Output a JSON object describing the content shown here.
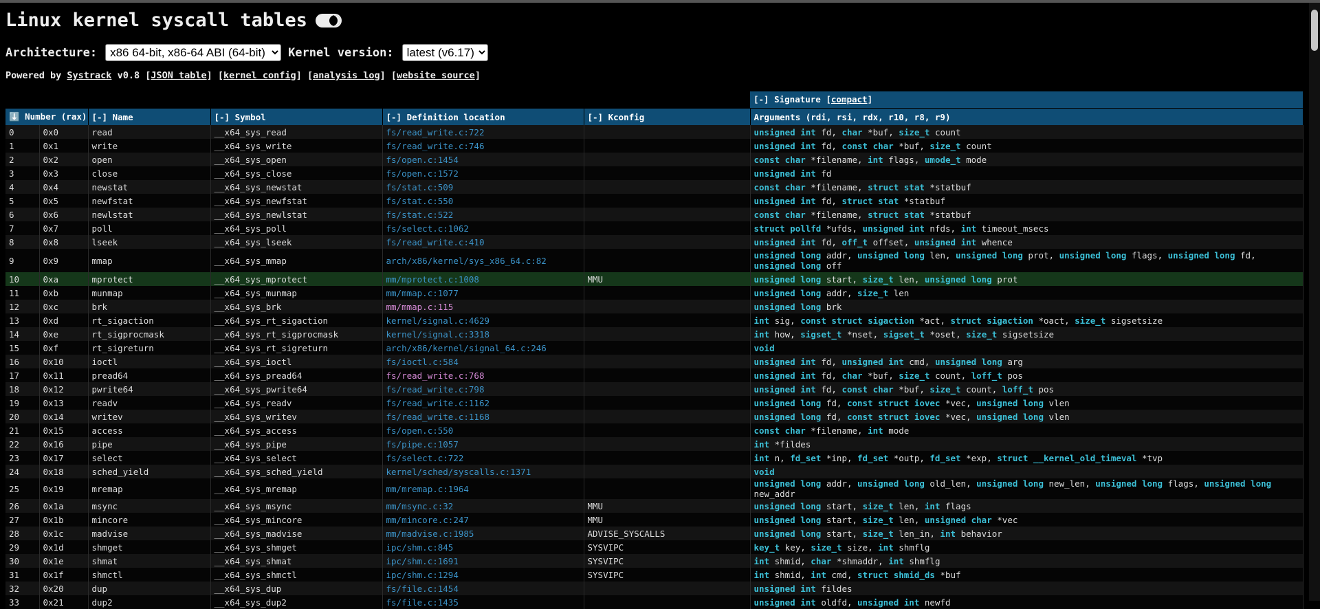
{
  "page": {
    "title": "Linux kernel syscall tables",
    "arch_label": "Architecture:",
    "arch_value": "x86 64-bit, x86-64 ABI (64-bit)",
    "kernel_label": "Kernel version:",
    "kernel_value": "latest (v6.17)",
    "powered_prefix": "Powered by ",
    "powered_link": "Systrack",
    "powered_version": " v0.8 [",
    "link_json": "JSON table",
    "link_config": "kernel config",
    "link_log": "analysis log",
    "link_source": "website source",
    "sep1": "] [",
    "sep2": "] [",
    "sep3": "] [",
    "end": "]"
  },
  "signature_header": {
    "prefix": "[-] Signature [",
    "link": "compact",
    "suffix": "]"
  },
  "columns": [
    "⬇️ Number (rax)",
    "[-] Name",
    "[-] Symbol",
    "[-] Definition location",
    "[-] Kconfig",
    "Arguments (rdi, rsi, rdx, r10, r8, r9)"
  ],
  "rows": [
    {
      "num": "0",
      "hex": "0x0",
      "name": "read",
      "symbol": "__x64_sys_read",
      "loc": "fs/read_write.c:722",
      "kconfig": "",
      "args": [
        [
          "unsigned int",
          "fd, "
        ],
        [
          "char",
          "*buf, "
        ],
        [
          "size_t",
          "count"
        ]
      ]
    },
    {
      "num": "1",
      "hex": "0x1",
      "name": "write",
      "symbol": "__x64_sys_write",
      "loc": "fs/read_write.c:746",
      "kconfig": "",
      "args": [
        [
          "unsigned int",
          "fd, "
        ],
        [
          "const char",
          "*buf, "
        ],
        [
          "size_t",
          "count"
        ]
      ]
    },
    {
      "num": "2",
      "hex": "0x2",
      "name": "open",
      "symbol": "__x64_sys_open",
      "loc": "fs/open.c:1454",
      "kconfig": "",
      "args": [
        [
          "const char",
          "*filename, "
        ],
        [
          "int",
          "flags, "
        ],
        [
          "umode_t",
          "mode"
        ]
      ]
    },
    {
      "num": "3",
      "hex": "0x3",
      "name": "close",
      "symbol": "__x64_sys_close",
      "loc": "fs/open.c:1572",
      "kconfig": "",
      "args": [
        [
          "unsigned int",
          "fd"
        ]
      ]
    },
    {
      "num": "4",
      "hex": "0x4",
      "name": "newstat",
      "symbol": "__x64_sys_newstat",
      "loc": "fs/stat.c:509",
      "kconfig": "",
      "args": [
        [
          "const char",
          "*filename, "
        ],
        [
          "struct stat",
          "*statbuf"
        ]
      ]
    },
    {
      "num": "5",
      "hex": "0x5",
      "name": "newfstat",
      "symbol": "__x64_sys_newfstat",
      "loc": "fs/stat.c:550",
      "kconfig": "",
      "args": [
        [
          "unsigned int",
          "fd, "
        ],
        [
          "struct stat",
          "*statbuf"
        ]
      ]
    },
    {
      "num": "6",
      "hex": "0x6",
      "name": "newlstat",
      "symbol": "__x64_sys_newlstat",
      "loc": "fs/stat.c:522",
      "kconfig": "",
      "args": [
        [
          "const char",
          "*filename, "
        ],
        [
          "struct stat",
          "*statbuf"
        ]
      ]
    },
    {
      "num": "7",
      "hex": "0x7",
      "name": "poll",
      "symbol": "__x64_sys_poll",
      "loc": "fs/select.c:1062",
      "kconfig": "",
      "args": [
        [
          "struct pollfd",
          "*ufds, "
        ],
        [
          "unsigned int",
          "nfds, "
        ],
        [
          "int",
          "timeout_msecs"
        ]
      ]
    },
    {
      "num": "8",
      "hex": "0x8",
      "name": "lseek",
      "symbol": "__x64_sys_lseek",
      "loc": "fs/read_write.c:410",
      "kconfig": "",
      "args": [
        [
          "unsigned int",
          "fd, "
        ],
        [
          "off_t",
          "offset, "
        ],
        [
          "unsigned int",
          "whence"
        ]
      ]
    },
    {
      "num": "9",
      "hex": "0x9",
      "name": "mmap",
      "symbol": "__x64_sys_mmap",
      "loc": "arch/x86/kernel/sys_x86_64.c:82",
      "kconfig": "",
      "tall": true,
      "args": [
        [
          "unsigned long",
          "addr, "
        ],
        [
          "unsigned long",
          "len, "
        ],
        [
          "unsigned long",
          "prot, "
        ],
        [
          "unsigned long",
          "flags, "
        ],
        [
          "unsigned long",
          "fd, "
        ],
        [
          "unsigned long",
          "off"
        ]
      ]
    },
    {
      "num": "10",
      "hex": "0xa",
      "name": "mprotect",
      "symbol": "__x64_sys_mprotect",
      "loc": "mm/mprotect.c:1008",
      "kconfig": "MMU",
      "hl": true,
      "args": [
        [
          "unsigned long",
          "start, "
        ],
        [
          "size_t",
          "len, "
        ],
        [
          "unsigned long",
          "prot"
        ]
      ]
    },
    {
      "num": "11",
      "hex": "0xb",
      "name": "munmap",
      "symbol": "__x64_sys_munmap",
      "loc": "mm/mmap.c:1077",
      "kconfig": "",
      "args": [
        [
          "unsigned long",
          "addr, "
        ],
        [
          "size_t",
          "len"
        ]
      ]
    },
    {
      "num": "12",
      "hex": "0xc",
      "name": "brk",
      "symbol": "__x64_sys_brk",
      "loc": "mm/mmap.c:115",
      "kconfig": "",
      "visited": true,
      "args": [
        [
          "unsigned long",
          "brk"
        ]
      ]
    },
    {
      "num": "13",
      "hex": "0xd",
      "name": "rt_sigaction",
      "symbol": "__x64_sys_rt_sigaction",
      "loc": "kernel/signal.c:4629",
      "kconfig": "",
      "args": [
        [
          "int",
          "sig, "
        ],
        [
          "const struct sigaction",
          "*act, "
        ],
        [
          "struct sigaction",
          "*oact, "
        ],
        [
          "size_t",
          "sigsetsize"
        ]
      ]
    },
    {
      "num": "14",
      "hex": "0xe",
      "name": "rt_sigprocmask",
      "symbol": "__x64_sys_rt_sigprocmask",
      "loc": "kernel/signal.c:3318",
      "kconfig": "",
      "args": [
        [
          "int",
          "how, "
        ],
        [
          "sigset_t",
          "*nset, "
        ],
        [
          "sigset_t",
          "*oset, "
        ],
        [
          "size_t",
          "sigsetsize"
        ]
      ]
    },
    {
      "num": "15",
      "hex": "0xf",
      "name": "rt_sigreturn",
      "symbol": "__x64_sys_rt_sigreturn",
      "loc": "arch/x86/kernel/signal_64.c:246",
      "kconfig": "",
      "args": [
        [
          "void",
          ""
        ]
      ]
    },
    {
      "num": "16",
      "hex": "0x10",
      "name": "ioctl",
      "symbol": "__x64_sys_ioctl",
      "loc": "fs/ioctl.c:584",
      "kconfig": "",
      "args": [
        [
          "unsigned int",
          "fd, "
        ],
        [
          "unsigned int",
          "cmd, "
        ],
        [
          "unsigned long",
          "arg"
        ]
      ]
    },
    {
      "num": "17",
      "hex": "0x11",
      "name": "pread64",
      "symbol": "__x64_sys_pread64",
      "loc": "fs/read_write.c:768",
      "kconfig": "",
      "visited": true,
      "args": [
        [
          "unsigned int",
          "fd, "
        ],
        [
          "char",
          "*buf, "
        ],
        [
          "size_t",
          "count, "
        ],
        [
          "loff_t",
          "pos"
        ]
      ]
    },
    {
      "num": "18",
      "hex": "0x12",
      "name": "pwrite64",
      "symbol": "__x64_sys_pwrite64",
      "loc": "fs/read_write.c:798",
      "kconfig": "",
      "args": [
        [
          "unsigned int",
          "fd, "
        ],
        [
          "const char",
          "*buf, "
        ],
        [
          "size_t",
          "count, "
        ],
        [
          "loff_t",
          "pos"
        ]
      ]
    },
    {
      "num": "19",
      "hex": "0x13",
      "name": "readv",
      "symbol": "__x64_sys_readv",
      "loc": "fs/read_write.c:1162",
      "kconfig": "",
      "args": [
        [
          "unsigned long",
          "fd, "
        ],
        [
          "const struct iovec",
          "*vec, "
        ],
        [
          "unsigned long",
          "vlen"
        ]
      ]
    },
    {
      "num": "20",
      "hex": "0x14",
      "name": "writev",
      "symbol": "__x64_sys_writev",
      "loc": "fs/read_write.c:1168",
      "kconfig": "",
      "args": [
        [
          "unsigned long",
          "fd, "
        ],
        [
          "const struct iovec",
          "*vec, "
        ],
        [
          "unsigned long",
          "vlen"
        ]
      ]
    },
    {
      "num": "21",
      "hex": "0x15",
      "name": "access",
      "symbol": "__x64_sys_access",
      "loc": "fs/open.c:550",
      "kconfig": "",
      "args": [
        [
          "const char",
          "*filename, "
        ],
        [
          "int",
          "mode"
        ]
      ]
    },
    {
      "num": "22",
      "hex": "0x16",
      "name": "pipe",
      "symbol": "__x64_sys_pipe",
      "loc": "fs/pipe.c:1057",
      "kconfig": "",
      "args": [
        [
          "int",
          "*fildes"
        ]
      ]
    },
    {
      "num": "23",
      "hex": "0x17",
      "name": "select",
      "symbol": "__x64_sys_select",
      "loc": "fs/select.c:722",
      "kconfig": "",
      "args": [
        [
          "int",
          "n, "
        ],
        [
          "fd_set",
          "*inp, "
        ],
        [
          "fd_set",
          "*outp, "
        ],
        [
          "fd_set",
          "*exp, "
        ],
        [
          "struct __kernel_old_timeval",
          "*tvp"
        ]
      ]
    },
    {
      "num": "24",
      "hex": "0x18",
      "name": "sched_yield",
      "symbol": "__x64_sys_sched_yield",
      "loc": "kernel/sched/syscalls.c:1371",
      "kconfig": "",
      "args": [
        [
          "void",
          ""
        ]
      ]
    },
    {
      "num": "25",
      "hex": "0x19",
      "name": "mremap",
      "symbol": "__x64_sys_mremap",
      "loc": "mm/mremap.c:1964",
      "kconfig": "",
      "args": [
        [
          "unsigned long",
          "addr, "
        ],
        [
          "unsigned long",
          "old_len, "
        ],
        [
          "unsigned long",
          "new_len, "
        ],
        [
          "unsigned long",
          "flags, "
        ],
        [
          "unsigned long",
          "new_addr"
        ]
      ]
    },
    {
      "num": "26",
      "hex": "0x1a",
      "name": "msync",
      "symbol": "__x64_sys_msync",
      "loc": "mm/msync.c:32",
      "kconfig": "MMU",
      "args": [
        [
          "unsigned long",
          "start, "
        ],
        [
          "size_t",
          "len, "
        ],
        [
          "int",
          "flags"
        ]
      ]
    },
    {
      "num": "27",
      "hex": "0x1b",
      "name": "mincore",
      "symbol": "__x64_sys_mincore",
      "loc": "mm/mincore.c:247",
      "kconfig": "MMU",
      "args": [
        [
          "unsigned long",
          "start, "
        ],
        [
          "size_t",
          "len, "
        ],
        [
          "unsigned char",
          "*vec"
        ]
      ]
    },
    {
      "num": "28",
      "hex": "0x1c",
      "name": "madvise",
      "symbol": "__x64_sys_madvise",
      "loc": "mm/madvise.c:1985",
      "kconfig": "ADVISE_SYSCALLS",
      "args": [
        [
          "unsigned long",
          "start, "
        ],
        [
          "size_t",
          "len_in, "
        ],
        [
          "int",
          "behavior"
        ]
      ]
    },
    {
      "num": "29",
      "hex": "0x1d",
      "name": "shmget",
      "symbol": "__x64_sys_shmget",
      "loc": "ipc/shm.c:845",
      "kconfig": "SYSVIPC",
      "args": [
        [
          "key_t",
          "key, "
        ],
        [
          "size_t",
          "size, "
        ],
        [
          "int",
          "shmflg"
        ]
      ]
    },
    {
      "num": "30",
      "hex": "0x1e",
      "name": "shmat",
      "symbol": "__x64_sys_shmat",
      "loc": "ipc/shm.c:1691",
      "kconfig": "SYSVIPC",
      "args": [
        [
          "int",
          "shmid, "
        ],
        [
          "char",
          "*shmaddr, "
        ],
        [
          "int",
          "shmflg"
        ]
      ]
    },
    {
      "num": "31",
      "hex": "0x1f",
      "name": "shmctl",
      "symbol": "__x64_sys_shmctl",
      "loc": "ipc/shm.c:1294",
      "kconfig": "SYSVIPC",
      "args": [
        [
          "int",
          "shmid, "
        ],
        [
          "int",
          "cmd, "
        ],
        [
          "struct shmid_ds",
          "*buf"
        ]
      ]
    },
    {
      "num": "32",
      "hex": "0x20",
      "name": "dup",
      "symbol": "__x64_sys_dup",
      "loc": "fs/file.c:1454",
      "kconfig": "",
      "args": [
        [
          "unsigned int",
          "fildes"
        ]
      ]
    },
    {
      "num": "33",
      "hex": "0x21",
      "name": "dup2",
      "symbol": "__x64_sys_dup2",
      "loc": "fs/file.c:1435",
      "kconfig": "",
      "args": [
        [
          "unsigned int",
          "oldfd, "
        ],
        [
          "unsigned int",
          "newfd"
        ]
      ]
    }
  ],
  "colors": {
    "header_bg": "#0f4d75",
    "keyword": "#3cbfd6",
    "link": "#3b93c8",
    "visited": "#d58ad6",
    "highlight_row": "#15371a"
  }
}
